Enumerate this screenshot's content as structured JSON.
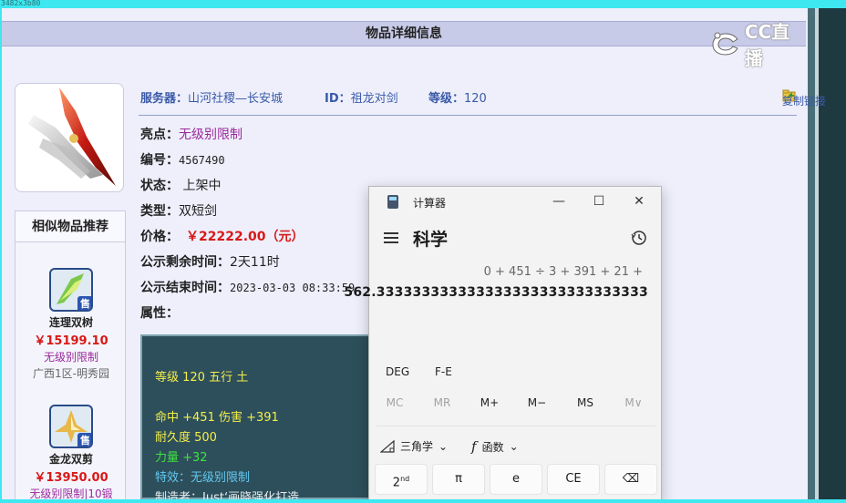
{
  "topbar": {
    "text": "3482x3b80"
  },
  "header": {
    "title": "物品详细信息"
  },
  "cc_logo": {
    "text": "CC直播"
  },
  "info": {
    "server_label": "服务器：",
    "server_value": "山河社稷—长安城",
    "id_label": "ID：",
    "id_value": "祖龙对剑",
    "level_label": "等级：",
    "level_value": "120",
    "copy_link": "复制链接"
  },
  "fields": [
    {
      "label": "亮点：",
      "value": "无级别限制"
    },
    {
      "label": "编号：",
      "value": "4567490"
    },
    {
      "label": "状态：",
      "value": " 上架中"
    },
    {
      "label": "类型：",
      "value": "双短剑"
    },
    {
      "label": "价格：",
      "value": "￥22222.00（元）"
    },
    {
      "label": "公示剩余时间：",
      "value": "2天11时"
    },
    {
      "label": "公示结束时间：",
      "value": "2023-03-03 08:33:59"
    },
    {
      "label": "属性：",
      "value": ""
    }
  ],
  "similar": {
    "title": "相似物品推荐",
    "items": [
      {
        "name": "连理双树",
        "price": "￥15199.10",
        "tag": "无级别限制",
        "server": "广西1区-明秀园",
        "badge": "售"
      },
      {
        "name": "金龙双剪",
        "price": "￥13950.00",
        "tag": "无级别限制|10锻",
        "server": "",
        "badge": "售"
      }
    ]
  },
  "attributes": [
    {
      "text": "等级 120 五行 土",
      "color": "yellow"
    },
    {
      "text": "命中 +451 伤害 +391",
      "color": "yellow"
    },
    {
      "text": "耐久度 500",
      "color": "yellow"
    },
    {
      "text": "力量 +32",
      "color": "green"
    },
    {
      "text": "特效：无级别限制",
      "color": "cyan"
    },
    {
      "text": "制造者：Just‘画晓强化打造",
      "color": "white"
    }
  ],
  "calculator": {
    "title": "计算器",
    "mode": "科学",
    "expression": "0 + 451 ÷ 3 + 391 + 21 +",
    "result": "562.333333333333333333333333333333",
    "angle": [
      "DEG",
      "F-E"
    ],
    "memory": [
      "MC",
      "MR",
      "M+",
      "M−",
      "MS",
      "M∨"
    ],
    "func": {
      "trig": "三角学",
      "functions": "函数"
    },
    "keys": [
      "2nd",
      "π",
      "e",
      "CE",
      "⌫"
    ],
    "window": {
      "minimize": "—",
      "maximize": "☐",
      "close": "✕"
    }
  }
}
